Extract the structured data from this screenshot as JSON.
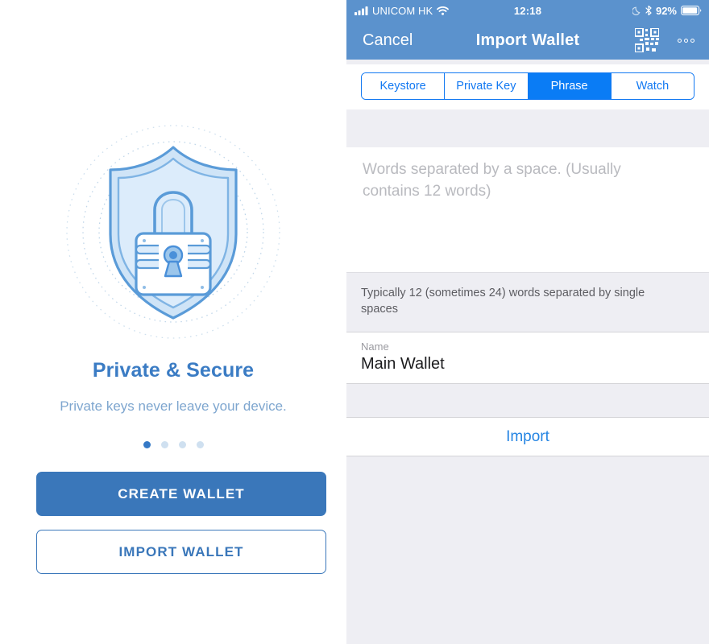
{
  "left": {
    "illustration": {
      "name": "shield-lock-illustration",
      "shield_fill": "#d6e7f8",
      "shield_stroke": "#4a90d9",
      "ring_color": "#c3d8ea"
    },
    "headline": "Private & Secure",
    "subhead": "Private keys never leave your device.",
    "pager": {
      "total": 4,
      "active_index": 0
    },
    "buttons": {
      "create": "CREATE WALLET",
      "import": "IMPORT WALLET"
    },
    "colors": {
      "primary": "#3a77ba",
      "headline": "#3b7cc4",
      "subhead": "#7ea6cf"
    }
  },
  "right": {
    "statusbar": {
      "carrier": "UNICOM HK",
      "time": "12:18",
      "battery_percent": "92%",
      "icons": [
        "signal-bars-icon",
        "wifi-icon",
        "moon-icon",
        "bluetooth-icon",
        "battery-icon"
      ]
    },
    "navbar": {
      "cancel": "Cancel",
      "title": "Import Wallet",
      "qr_icon": "qr-code-icon",
      "more_icon": "more-dots-icon",
      "background": "#5b92cd"
    },
    "segmented": {
      "options": [
        "Keystore",
        "Private Key",
        "Phrase",
        "Watch"
      ],
      "selected": "Phrase",
      "accent": "#0a7cf5"
    },
    "phrase": {
      "value": "",
      "placeholder": "Words separated by a space. (Usually contains 12 words)"
    },
    "hint": "Typically 12 (sometimes 24) words separated by single spaces",
    "name_field": {
      "label": "Name",
      "value": "Main Wallet"
    },
    "import_button": {
      "label": "Import",
      "color": "#2585e3"
    }
  }
}
